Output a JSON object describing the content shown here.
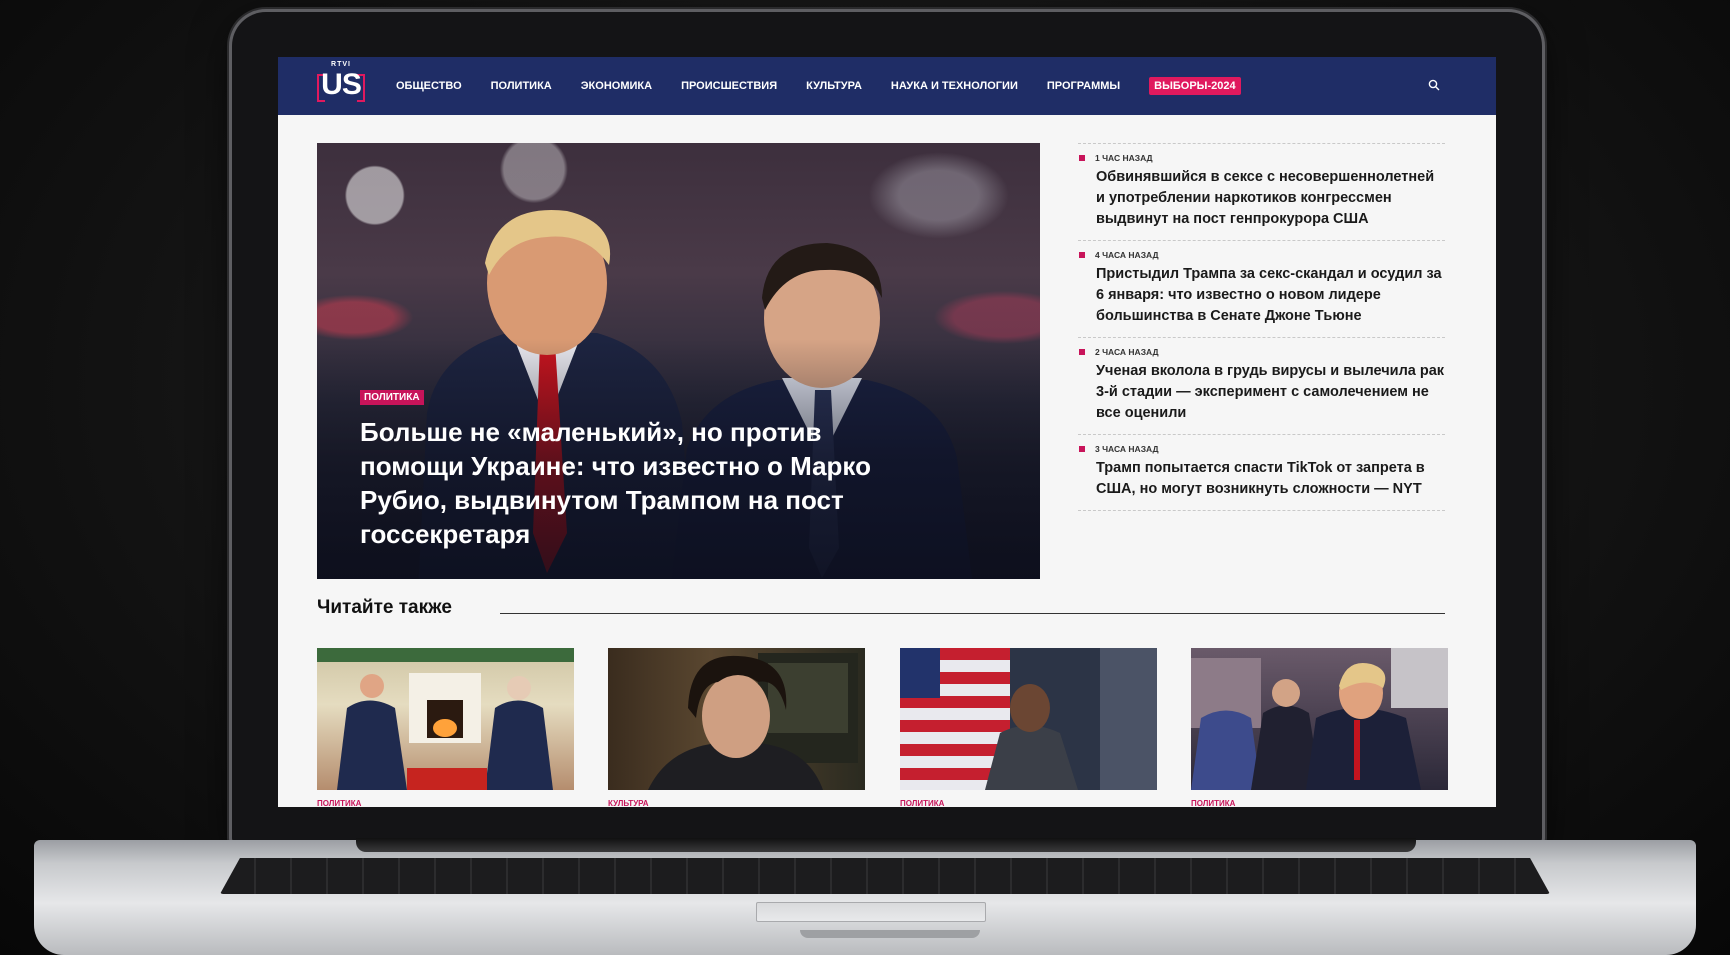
{
  "site": {
    "logo_top": "RTVI",
    "logo_main": "US",
    "nav": [
      "ОБЩЕСТВО",
      "ПОЛИТИКА",
      "ЭКОНОМИКА",
      "ПРОИСШЕСТВИЯ",
      "КУЛЬТУРА",
      "НАУКА И ТЕХНОЛОГИИ",
      "ПРОГРАММЫ"
    ],
    "nav_highlight": "ВЫБОРЫ-2024",
    "icons": {
      "search": "search-icon"
    },
    "colors": {
      "header": "#1f2d66",
      "accent": "#e0195e",
      "tag": "#c8145a"
    }
  },
  "hero": {
    "tag": "ПОЛИТИКА",
    "title": "Больше не «маленький», но против помощи Украине: что известно о Марко Рубио, выдвинутом Трампом на пост госсекретаря"
  },
  "news": [
    {
      "time": "1 ЧАС НАЗАД",
      "title": "Обвинявшийся в сексе с несовершеннолетней и употреблении наркотиков конгрессмен выдвинут на пост генпрокурора США"
    },
    {
      "time": "4 ЧАСА НАЗАД",
      "title": "Пристыдил Трампа за секс-скандал и осудил за 6 января: что известно о новом лидере большинства в Сенате Джоне Тьюне"
    },
    {
      "time": "2 ЧАСА НАЗАД",
      "title": "Ученая вколола в грудь вирусы и вылечила рак 3-й стадии — эксперимент с самолечением не все оценили"
    },
    {
      "time": "3 ЧАСА НАЗАД",
      "title": "Трамп попытается спасти TikTok от запрета в США, но могут возникнуть сложности — NYT"
    }
  ],
  "read_also": {
    "title": "Читайте также",
    "cards": [
      {
        "tag": "ПОЛИТИКА"
      },
      {
        "tag": "КУЛЬТУРА"
      },
      {
        "tag": "ПОЛИТИКА"
      },
      {
        "tag": "ПОЛИТИКА"
      }
    ]
  }
}
